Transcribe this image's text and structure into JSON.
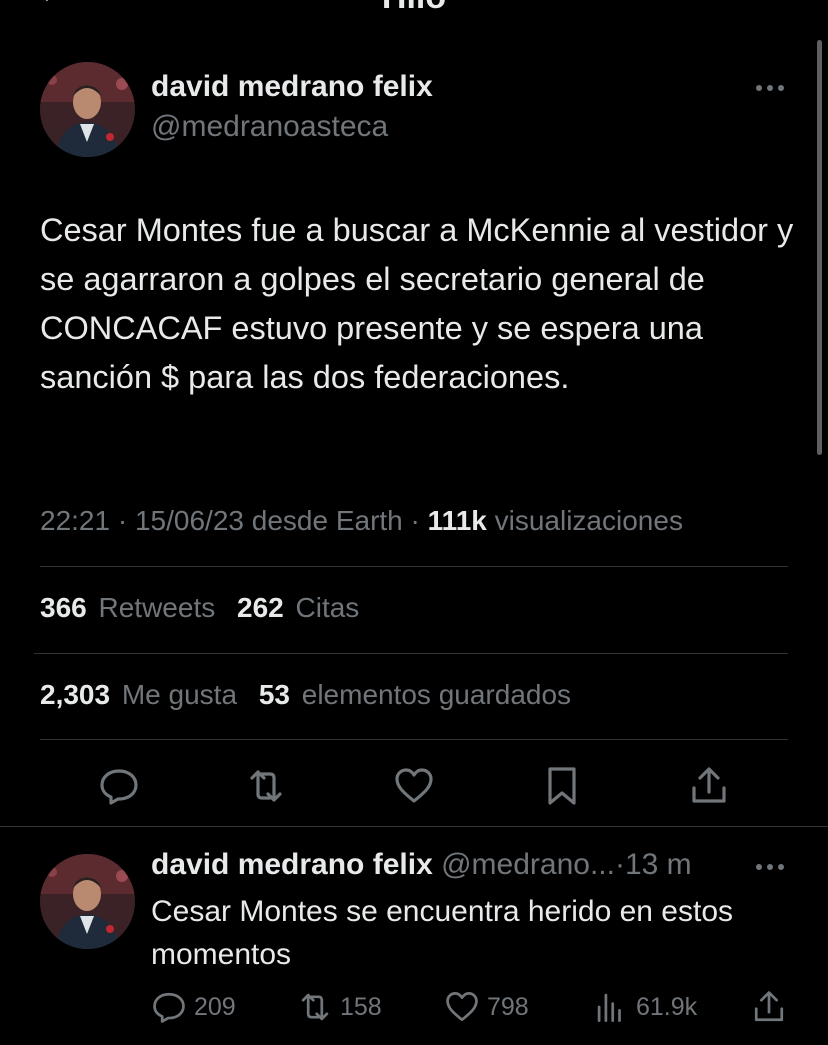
{
  "header": {
    "title": "Hilo"
  },
  "tweet": {
    "author_name": "david medrano felix",
    "author_handle": "@medranoasteca",
    "text": "Cesar Montes fue a buscar a McKennie al vestidor y se agarraron a golpes el secretario general de CONCACAF estuvo presente y se espera una sanción $ para las dos federaciones.",
    "time": "22:21",
    "date": "15/06/23",
    "source": "desde Earth",
    "views_count": "111k",
    "views_label": "visualizaciones",
    "retweets_count": "366",
    "retweets_label": "Retweets",
    "quotes_count": "262",
    "quotes_label": "Citas",
    "likes_count": "2,303",
    "likes_label": "Me gusta",
    "bookmarks_count": "53",
    "bookmarks_label": "elementos guardados",
    "actions": [
      "reply-icon",
      "retweet-icon",
      "like-icon",
      "bookmark-icon",
      "share-icon"
    ]
  },
  "reply": {
    "author_name": "david medrano felix",
    "author_handle": "@medrano...",
    "time": "13 m",
    "text": "Cesar Montes se encuentra herido en estos momentos",
    "replies": "209",
    "retweets": "158",
    "likes": "798",
    "views": "61.9k"
  },
  "colors": {
    "background": "#000000",
    "text": "#e7e9ea",
    "secondary": "#71767b",
    "divider": "#2f3336"
  }
}
